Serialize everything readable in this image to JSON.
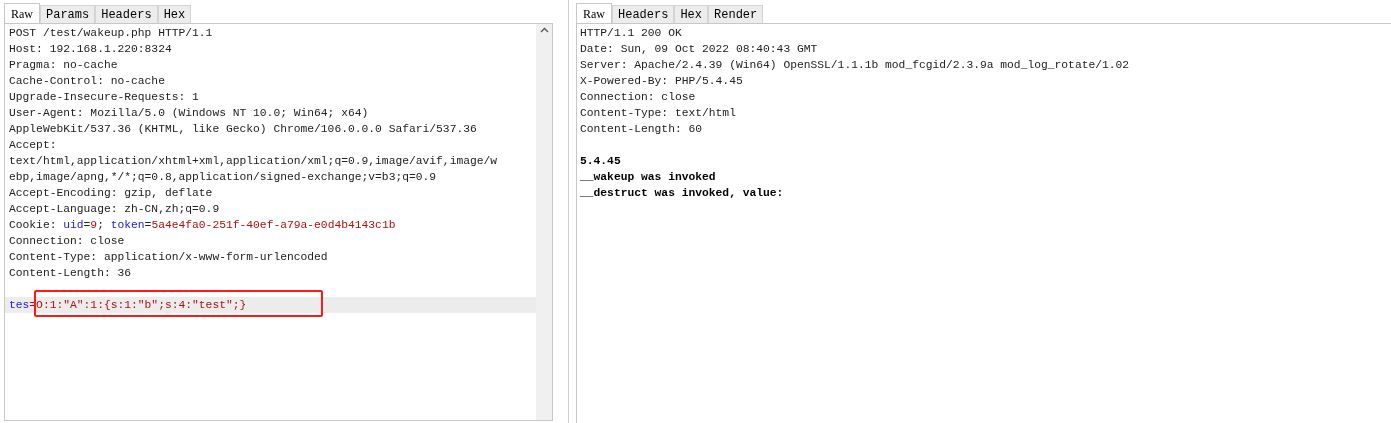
{
  "request": {
    "tabs": [
      {
        "label": "Raw",
        "selected": true
      },
      {
        "label": "Params",
        "selected": false
      },
      {
        "label": "Headers",
        "selected": false
      },
      {
        "label": "Hex",
        "selected": false
      }
    ],
    "headers": [
      [
        {
          "kind": "plain",
          "text": "POST /test/wakeup.php HTTP/1.1"
        }
      ],
      [
        {
          "kind": "plain",
          "text": "Host: 192.168.1.220:8324"
        }
      ],
      [
        {
          "kind": "plain",
          "text": "Pragma: no-cache"
        }
      ],
      [
        {
          "kind": "plain",
          "text": "Cache-Control: no-cache"
        }
      ],
      [
        {
          "kind": "plain",
          "text": "Upgrade-Insecure-Requests: 1"
        }
      ],
      [
        {
          "kind": "plain",
          "text": "User-Agent: Mozilla/5.0 (Windows NT 10.0; Win64; x64)"
        }
      ],
      [
        {
          "kind": "plain",
          "text": "AppleWebKit/537.36 (KHTML, like Gecko) Chrome/106.0.0.0 Safari/537.36"
        }
      ],
      [
        {
          "kind": "plain",
          "text": "Accept:"
        }
      ],
      [
        {
          "kind": "plain",
          "text": "text/html,application/xhtml+xml,application/xml;q=0.9,image/avif,image/w"
        }
      ],
      [
        {
          "kind": "plain",
          "text": "ebp,image/apng,*/*;q=0.8,application/signed-exchange;v=b3;q=0.9"
        }
      ],
      [
        {
          "kind": "plain",
          "text": "Accept-Encoding: gzip, deflate"
        }
      ],
      [
        {
          "kind": "plain",
          "text": "Accept-Language: zh-CN,zh;q=0.9"
        }
      ],
      [
        {
          "kind": "plain",
          "text": "Cookie: "
        },
        {
          "kind": "name",
          "text": "uid"
        },
        {
          "kind": "plain",
          "text": "="
        },
        {
          "kind": "value",
          "text": "9"
        },
        {
          "kind": "plain",
          "text": "; "
        },
        {
          "kind": "name",
          "text": "token"
        },
        {
          "kind": "plain",
          "text": "="
        },
        {
          "kind": "value",
          "text": "5a4e4fa0-251f-40ef-a79a-e0d4b4143c1b"
        }
      ],
      [
        {
          "kind": "plain",
          "text": "Connection: close"
        }
      ],
      [
        {
          "kind": "plain",
          "text": "Content-Type: application/x-www-form-urlencoded"
        }
      ],
      [
        {
          "kind": "plain",
          "text": "Content-Length: 36"
        }
      ]
    ],
    "body": [
      {
        "kind": "name",
        "text": "tes"
      },
      {
        "kind": "value",
        "text": "=O:1:\"A\":1:{s:1:\"b\";s:4:\"test\";}"
      }
    ]
  },
  "response": {
    "tabs": [
      {
        "label": "Raw",
        "selected": true
      },
      {
        "label": "Headers",
        "selected": false
      },
      {
        "label": "Hex",
        "selected": false
      },
      {
        "label": "Render",
        "selected": false
      }
    ],
    "headers": [
      "HTTP/1.1 200 OK",
      "Date: Sun, 09 Oct 2022 08:40:43 GMT",
      "Server: Apache/2.4.39 (Win64) OpenSSL/1.1.1b mod_fcgid/2.3.9a mod_log_rotate/1.02",
      "X-Powered-By: PHP/5.4.45",
      "Connection: close",
      "Content-Type: text/html",
      "Content-Length: 60"
    ],
    "body": [
      "5.4.45",
      "__wakeup was invoked",
      "__destruct was invoked, value:"
    ]
  }
}
